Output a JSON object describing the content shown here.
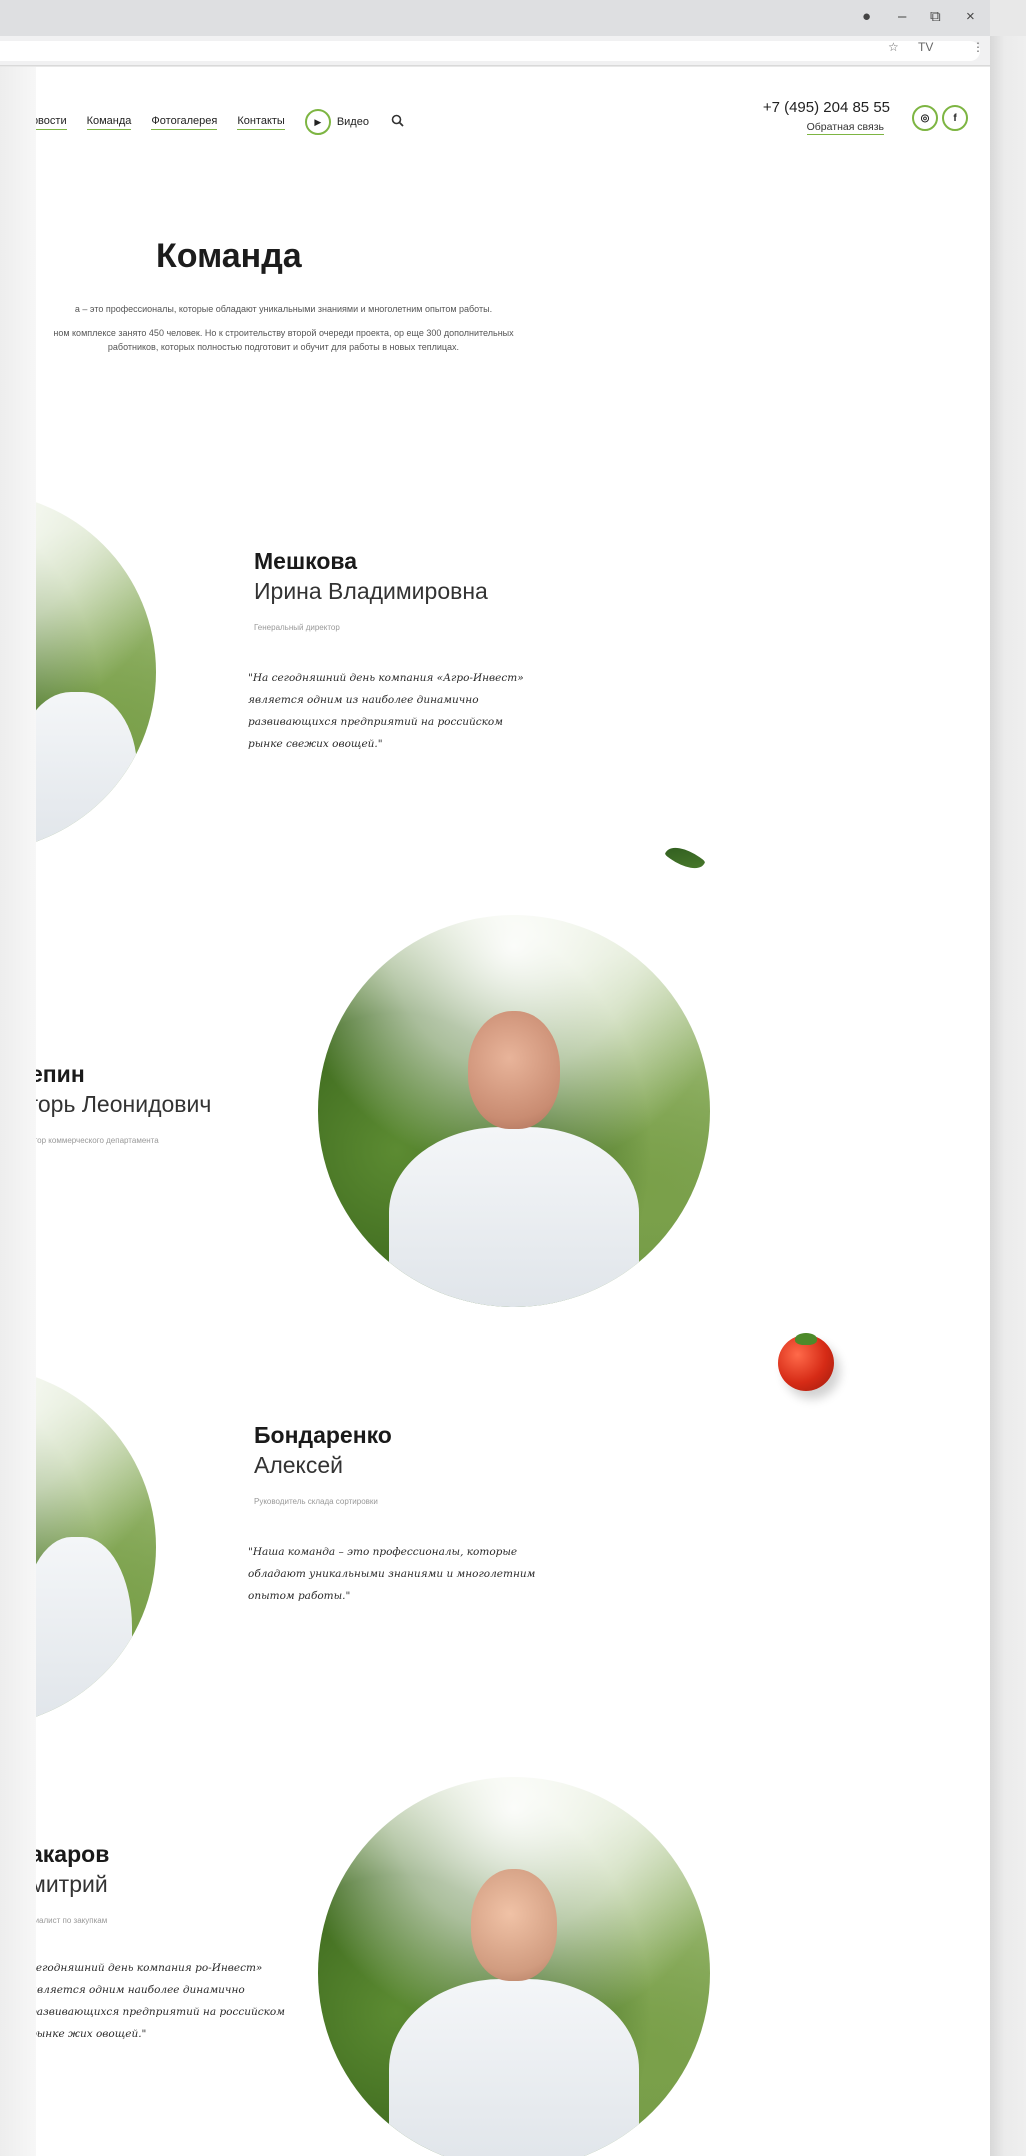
{
  "browser": {
    "window_controls": [
      "●",
      "–",
      "⧉",
      "×"
    ],
    "addr_icons": [
      "☆",
      "TV",
      "⋮"
    ]
  },
  "nav": {
    "links": [
      "Новости",
      "Команда",
      "Фотогалерея",
      "Контакты"
    ],
    "video_label": "Видео",
    "play_icon": "▶",
    "search_icon": "🔍",
    "phone": "+7 (495) 204 85 55",
    "callback": "Обратная связь",
    "social": [
      "◎",
      "f"
    ]
  },
  "intro": {
    "title": "Команда",
    "paragraph1": "а – это профессионалы, которые обладают уникальными знаниями и многолетним опытом работы.",
    "paragraph2": "ном комплексе занято 450 человек. Но к строительству второй очереди проекта, ор еще 300 дополнительных работников, которых полностью подготовит и обучит для работы в новых теплицах."
  },
  "team": [
    {
      "last_name": "Мешкова",
      "first_name": "Ирина Владимировна",
      "role": "Генеральный директор",
      "quote": "\"На сегодняшний день компания «Агро-Инвест» является одним из наиболее динамично развивающихся предприятий на российском рынке свежих овощей.\""
    },
    {
      "last_name": "епин",
      "first_name": "горь Леонидович",
      "role": "ктор коммерческого департамента"
    },
    {
      "last_name": "Бондаренко",
      "first_name": "Алексей",
      "role": "Руководитель склада сортировки",
      "quote": "\"Наша команда – это профессионалы, которые обладают уникальными знаниями и многолетним опытом работы.\""
    },
    {
      "last_name": "акаров",
      "first_name": "митрий",
      "role": "циалист по закупкам",
      "quote": "сегодняшний день компания ро-Инвест» является одним наиболее динамично развивающихся предприятий на российском рынке жих овощей.\""
    }
  ],
  "colors": {
    "accent": "#7db542",
    "text": "#1a1a1a"
  }
}
